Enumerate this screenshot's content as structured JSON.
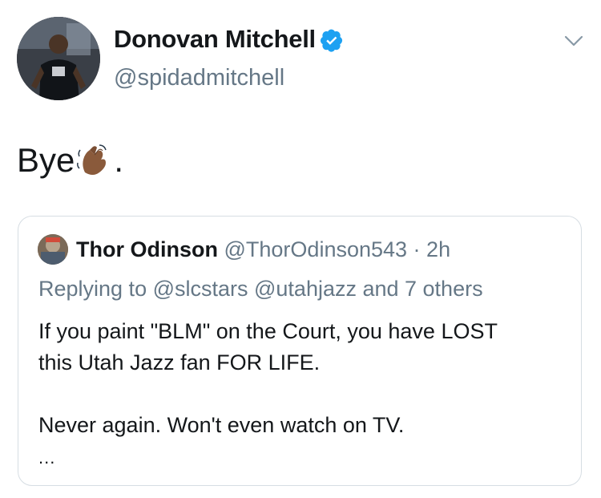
{
  "tweet": {
    "author_name": "Donovan Mitchell",
    "author_handle": "@spidadmitchell",
    "text_before": "Bye",
    "text_after": ".",
    "verified_color": "#1da1f2"
  },
  "quoted_tweet": {
    "author_name": "Thor Odinson",
    "author_handle": "@ThorOdinson543",
    "separator": " · ",
    "time": "2h",
    "replying_to": "Replying to @slcstars @utahjazz and 7 others",
    "body_line1": "If you paint \"BLM\" on the Court, you have LOST",
    "body_line2": "this Utah Jazz fan FOR LIFE.",
    "body_line3": "Never again.  Won't even watch on TV.",
    "ellipsis": "..."
  },
  "icons": [
    "verified-badge-icon",
    "chevron-down-icon",
    "waving-hand-icon"
  ],
  "colors": {
    "secondary_text": "#657786",
    "primary_text": "#14171a",
    "border": "#d6dde3"
  }
}
